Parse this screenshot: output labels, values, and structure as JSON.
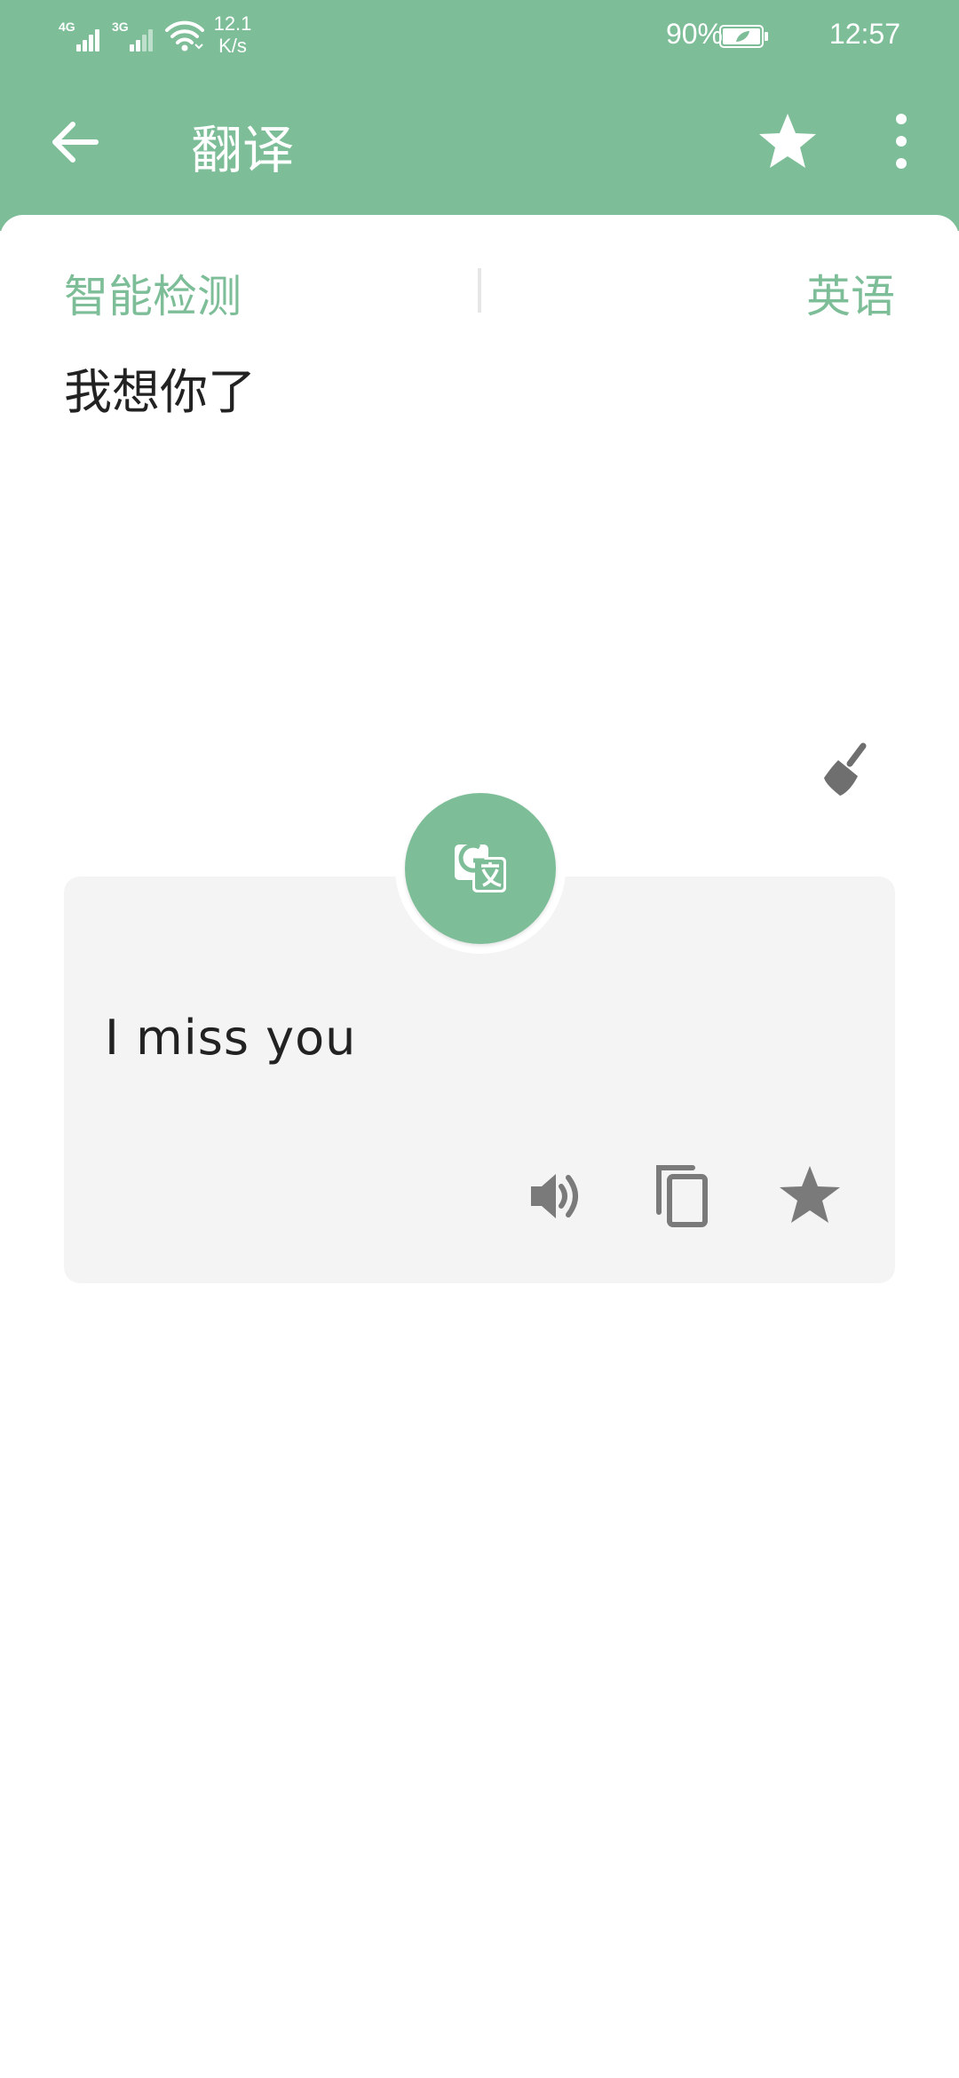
{
  "status_bar": {
    "network_1": "4G",
    "network_2": "3G",
    "speed_value": "12.1",
    "speed_unit": "K/s",
    "battery": "90%",
    "time": "12:57"
  },
  "toolbar": {
    "title": "翻译",
    "icons": [
      "back-arrow-icon",
      "star-icon",
      "more-vert-icon"
    ]
  },
  "languages": {
    "source": "智能检测",
    "target": "英语"
  },
  "input": {
    "text": "我想你了"
  },
  "result": {
    "text": "I miss you",
    "actions": [
      "speaker-icon",
      "copy-icon",
      "star-icon"
    ]
  },
  "colors": {
    "accent": "#7dbe98",
    "card_bg": "#f4f4f4",
    "icon_gray": "#7a7a7a",
    "text_dark": "#222222"
  }
}
